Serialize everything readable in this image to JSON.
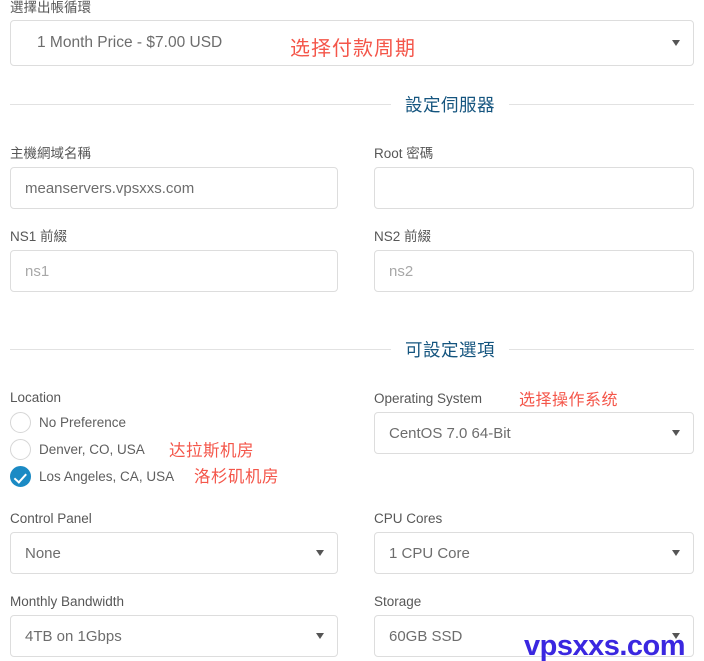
{
  "billing": {
    "label": "選擇出帳循環",
    "selected": "1 Month Price - $7.00 USD",
    "annotation": "选择付款周期"
  },
  "sections": {
    "server": "設定伺服器",
    "options": "可設定選項"
  },
  "server_fields": {
    "hostname": {
      "label": "主機網域名稱",
      "value": "meanservers.vpsxxs.com"
    },
    "root_password": {
      "label": "Root 密碼",
      "value": ""
    },
    "ns1": {
      "label": "NS1 前綴",
      "placeholder": "ns1"
    },
    "ns2": {
      "label": "NS2 前綴",
      "placeholder": "ns2"
    }
  },
  "location": {
    "label": "Location",
    "options": [
      {
        "label": "No Preference",
        "selected": false,
        "annotation": ""
      },
      {
        "label": "Denver, CO, USA",
        "selected": false,
        "annotation": "达拉斯机房"
      },
      {
        "label": "Los Angeles, CA, USA",
        "selected": true,
        "annotation": "洛杉矶机房"
      }
    ]
  },
  "operating_system": {
    "label": "Operating System",
    "annotation": "选择操作系统",
    "selected": "CentOS 7.0 64-Bit"
  },
  "control_panel": {
    "label": "Control Panel",
    "selected": "None"
  },
  "cpu_cores": {
    "label": "CPU Cores",
    "selected": "1 CPU Core"
  },
  "bandwidth": {
    "label": "Monthly Bandwidth",
    "selected": "4TB on 1Gbps"
  },
  "storage": {
    "label": "Storage",
    "selected": "60GB SSD"
  },
  "watermark": {
    "text": "vpsxxs.com",
    "color": "#3a27e0"
  },
  "colors": {
    "accent_blue": "#1b8ac4",
    "section_heading": "#15557f",
    "annotation_red": "#f4564a",
    "border": "#dddddd"
  }
}
